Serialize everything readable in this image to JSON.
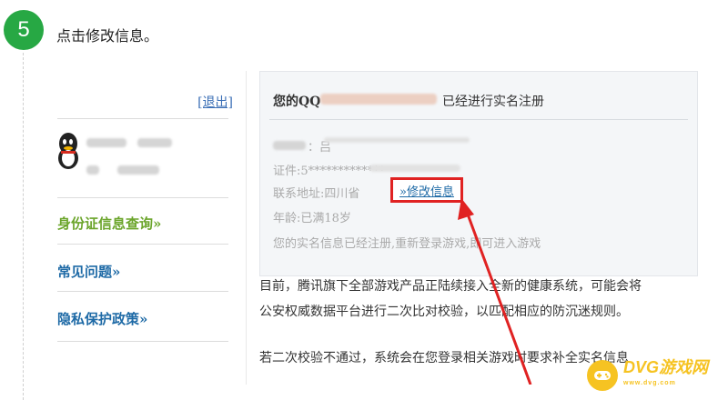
{
  "step": {
    "number": "5",
    "text": "点击修改信息。"
  },
  "left_panel": {
    "logout_label": "[退出]",
    "links": [
      "身份证信息查询»",
      "常见问题»",
      "隐私保护政策»"
    ]
  },
  "right_panel": {
    "title_prefix": "您的QQ",
    "title_suffix": "已经进行实名注册",
    "lines": [
      "：吕",
      "证件:5*************",
      "联系地址:四川省"
    ],
    "modify_link": "»修改信息",
    "age_line": "年龄:已满18岁",
    "notice_line": "您的实名信息已经注册,重新登录游戏,即可进入游戏"
  },
  "body_text": {
    "p1_line1": "目前，腾讯旗下全部游戏产品正陆续接入全新的健康系统，可能会将",
    "p1_line2": "公安权威数据平台进行二次比对校验，以匹配相应的防沉迷规则。",
    "p2_line1": "若二次校验不通过，系统会在您登录相关游戏时要求补全实名信息"
  },
  "watermark": {
    "name": "DVG游戏网",
    "sub": "www.dvg.com"
  },
  "colors": {
    "badge": "#27a844",
    "highlight": "#e02222",
    "link": "#1e6aa6",
    "green_link": "#6ba52b"
  }
}
